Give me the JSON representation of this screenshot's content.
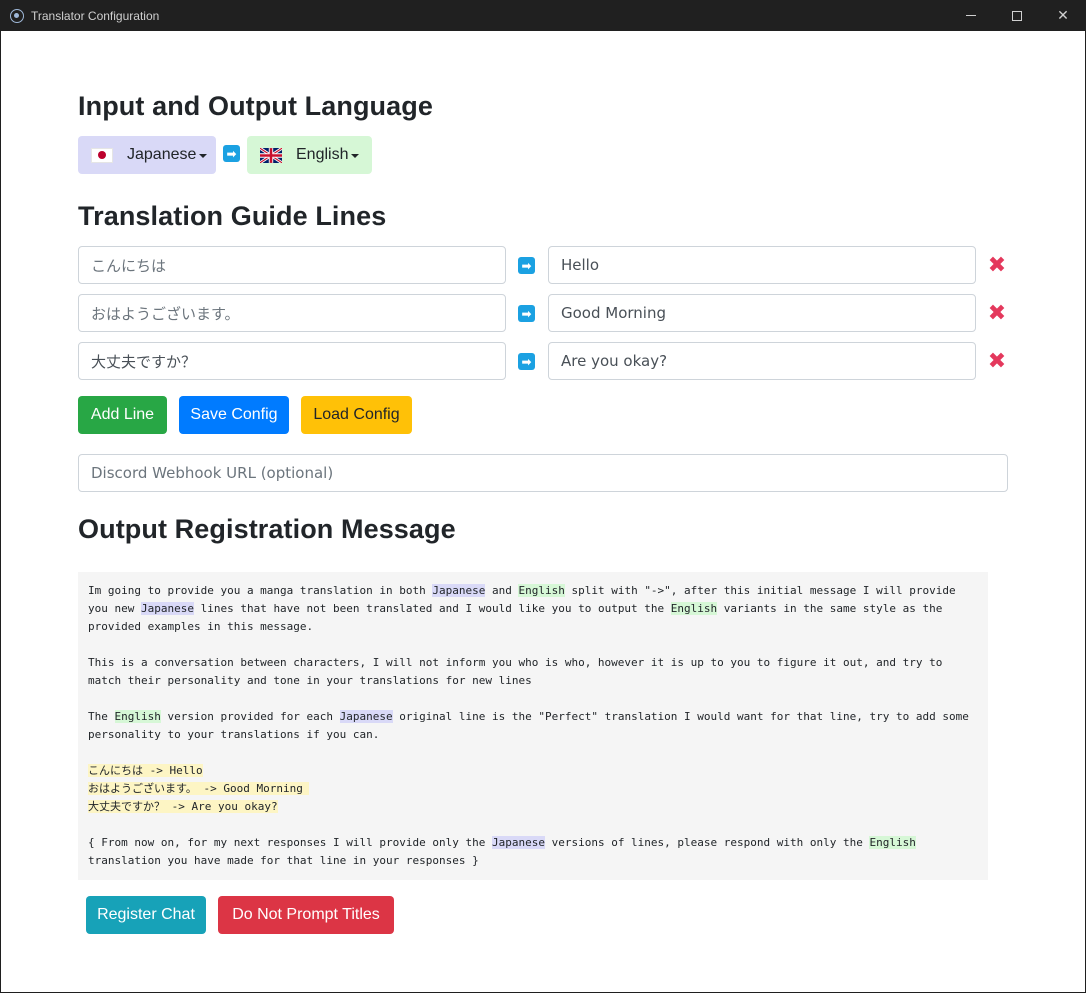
{
  "window": {
    "title": "Translator Configuration",
    "minimize": "—",
    "maximize": "",
    "close": "✕"
  },
  "sections": {
    "language_heading": "Input and Output Language",
    "guide_heading": "Translation Guide Lines",
    "output_heading": "Output Registration Message"
  },
  "languages": {
    "input": {
      "label": "Japanese",
      "flag_icon": "japan-flag-icon",
      "bg": "#d9d9f7"
    },
    "output": {
      "label": "English",
      "flag_icon": "uk-flag-icon",
      "bg": "#d6f7d6"
    },
    "arrow_icon": "right-arrow-icon"
  },
  "guide_lines": [
    {
      "source_value": "",
      "source_placeholder": "こんにちは",
      "target_value": "Hello"
    },
    {
      "source_value": "",
      "source_placeholder": "おはようございます。",
      "target_value": "Good Morning"
    },
    {
      "source_value": "大丈夫ですか？",
      "source_placeholder": "",
      "target_value": "Are you okay?"
    }
  ],
  "buttons": {
    "add_line": "Add Line",
    "save_config": "Save Config",
    "load_config": "Load Config",
    "register_chat": "Register Chat",
    "do_not_prompt_titles": "Do Not Prompt Titles"
  },
  "webhook": {
    "value": "",
    "placeholder": "Discord Webhook URL (optional)"
  },
  "message": {
    "p1_a": "Im going to provide you a manga translation in both ",
    "p1_jp1": "Japanese",
    "p1_b": " and ",
    "p1_en1": "English",
    "p1_c": " split with \"->\", after this initial message I will provide",
    "p1_d": "you new ",
    "p1_jp2": "Japanese",
    "p1_e": " lines that have not been translated and I would like you to output the ",
    "p1_en2": "English",
    "p1_f": " variants in the same style as the",
    "p1_g": "provided examples in this message.",
    "p2_a": "This is a conversation between characters, I will not inform you who is who, however it is up to you to figure it out, and try to",
    "p2_b": "match their personality and tone in your translations for new lines",
    "p3_a": "The ",
    "p3_en": "English",
    "p3_b": " version provided for each ",
    "p3_jp": "Japanese",
    "p3_c": " original line is the \"Perfect\" translation I would want for that line, try to add some",
    "p3_d": "personality to your translations if you can.",
    "ex1": "こんにちは -> Hello",
    "ex2": "おはようございます。 -> Good Morning ",
    "ex3": "大丈夫ですか？ -> Are you okay?",
    "p4_a": "{ From now on, for my next responses I will provide only the ",
    "p4_jp": "Japanese",
    "p4_b": " versions of lines, please respond with only the ",
    "p4_en": "English",
    "p4_c": "translation you have made for that line in your responses }"
  }
}
